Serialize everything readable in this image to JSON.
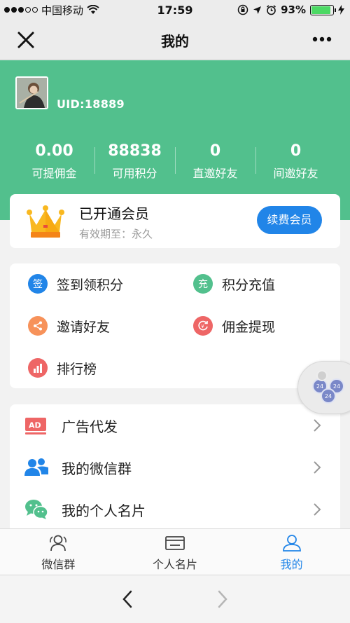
{
  "status_bar": {
    "carrier": "中国移动",
    "time": "17:59",
    "battery": "93%"
  },
  "nav": {
    "title": "我的"
  },
  "profile": {
    "uid": "UID:18889"
  },
  "stats": [
    {
      "value": "0.00",
      "label": "可提佣金"
    },
    {
      "value": "88838",
      "label": "可用积分"
    },
    {
      "value": "0",
      "label": "直邀好友"
    },
    {
      "value": "0",
      "label": "间邀好友"
    }
  ],
  "membership": {
    "title": "已开通会员",
    "validity": "有效期至：永久",
    "renew_label": "续费会员"
  },
  "quick_menu": [
    {
      "icon": "sign-in-icon",
      "glyph": "签",
      "label": "签到领积分",
      "color": "#2185e8"
    },
    {
      "icon": "recharge-icon",
      "glyph": "充",
      "label": "积分充值",
      "color": "#52c08d"
    },
    {
      "icon": "share-icon",
      "glyph": "",
      "label": "邀请好友",
      "color": "#f7925a"
    },
    {
      "icon": "withdraw-icon",
      "glyph": "",
      "label": "佣金提现",
      "color": "#ee6666"
    },
    {
      "icon": "ranking-icon",
      "glyph": "",
      "label": "排行榜",
      "color": "#ee6666"
    }
  ],
  "list_menu": [
    {
      "icon": "ad-icon",
      "label": "广告代发"
    },
    {
      "icon": "wechat-group-icon",
      "label": "我的微信群"
    },
    {
      "icon": "wechat-icon",
      "label": "我的个人名片"
    }
  ],
  "tabs": [
    {
      "icon": "group-icon",
      "label": "微信群"
    },
    {
      "icon": "card-icon",
      "label": "个人名片"
    },
    {
      "icon": "user-icon",
      "label": "我的"
    }
  ],
  "colors": {
    "primary_green": "#52c08d",
    "accent_blue": "#2185e8"
  }
}
